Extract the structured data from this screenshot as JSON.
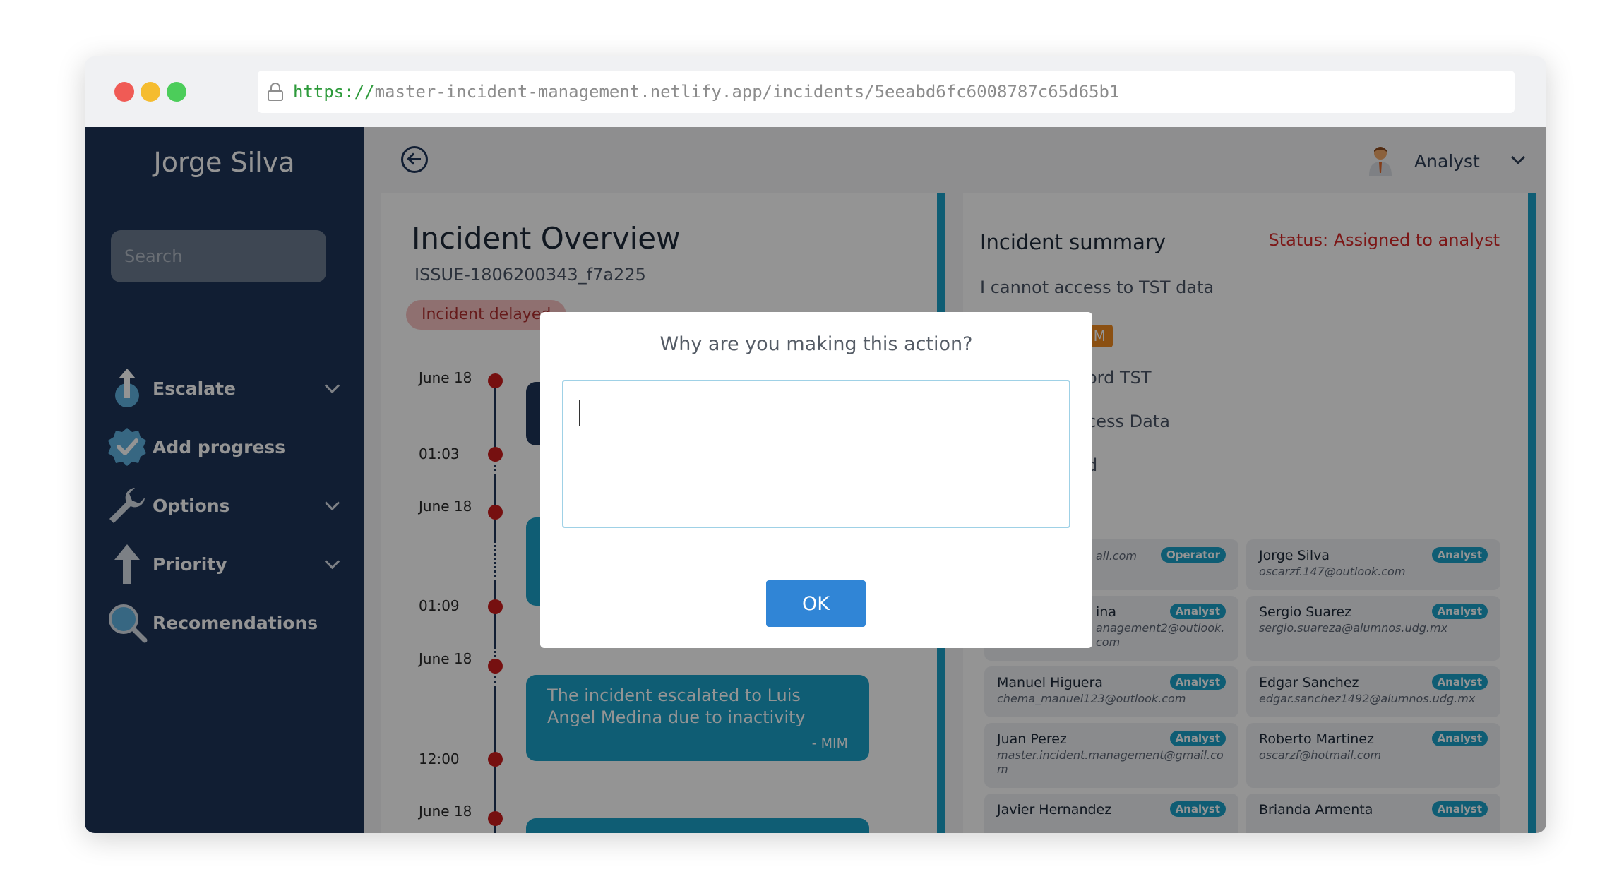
{
  "browser": {
    "url_scheme": "https://",
    "url_rest": "master-incident-management.netlify.app/incidents/5eeabd6fc6008787c65d65b1"
  },
  "sidebar": {
    "user_name": "Jorge Silva",
    "search_placeholder": "Search",
    "items": [
      {
        "label": "Escalate",
        "icon": "escalate-icon",
        "has_dropdown": true
      },
      {
        "label": "Add progress",
        "icon": "verified-check-icon",
        "has_dropdown": false
      },
      {
        "label": "Options",
        "icon": "wrench-icon",
        "has_dropdown": true
      },
      {
        "label": "Priority",
        "icon": "arrow-up-icon",
        "has_dropdown": true
      },
      {
        "label": "Recomendations",
        "icon": "magnifier-icon",
        "has_dropdown": false
      }
    ]
  },
  "topbar": {
    "role": "Analyst"
  },
  "overview": {
    "title": "Incident Overview",
    "issue_id": "ISSUE-1806200343_f7a225",
    "badge": "Incident delayed",
    "timeline_labels": [
      "June 18",
      "01:03",
      "June 18",
      "01:09",
      "June 18",
      "12:00",
      "June 18"
    ],
    "cards": [
      {
        "text": "The incident escalated to Luis Angel Medina due to inactivity",
        "signature": "- MIM"
      }
    ]
  },
  "summary": {
    "title": "Incident summary",
    "status": "Status: Assigned to analyst",
    "description": "I cannot access to TST data",
    "partial_lines": [
      "UM",
      "ord TST",
      "cess Data",
      "d"
    ],
    "users": [
      {
        "name": "",
        "email": "ail.com",
        "role": "Operator"
      },
      {
        "name": "Jorge Silva",
        "email": "oscarzf.147@outlook.com",
        "role": "Analyst"
      },
      {
        "name": "ina",
        "email": "anagement2@outlook.com",
        "role": "Analyst"
      },
      {
        "name": "Sergio Suarez",
        "email": "sergio.suareza@alumnos.udg.mx",
        "role": "Analyst"
      },
      {
        "name": "Manuel Higuera",
        "email": "chema_manuel123@outlook.com",
        "role": "Analyst"
      },
      {
        "name": "Edgar Sanchez",
        "email": "edgar.sanchez1492@alumnos.udg.mx",
        "role": "Analyst"
      },
      {
        "name": "Juan Perez",
        "email": "master.incident.management@gmail.com",
        "role": "Analyst"
      },
      {
        "name": "Roberto Martinez",
        "email": "oscarzf@hotmail.com",
        "role": "Analyst"
      },
      {
        "name": "Javier Hernandez",
        "email": "",
        "role": "Analyst"
      },
      {
        "name": "Brianda Armenta",
        "email": "",
        "role": "Analyst"
      }
    ]
  },
  "modal": {
    "question": "Why are you making this action?",
    "input_value": "",
    "ok_label": "OK"
  },
  "colors": {
    "sidebar": "#1e3458",
    "accent": "#1aa0c8",
    "status_red": "#d62828",
    "button_blue": "#3085d6"
  }
}
